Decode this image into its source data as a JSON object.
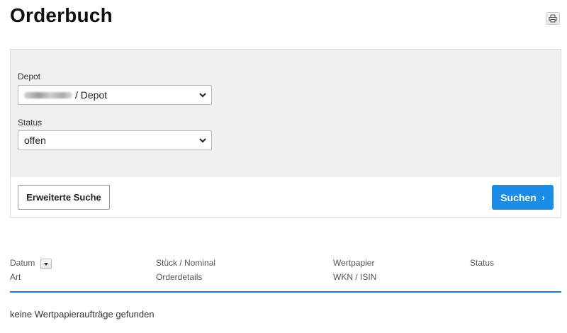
{
  "page": {
    "title": "Orderbuch",
    "print_icon": "printer-icon"
  },
  "search": {
    "depot_label": "Depot",
    "depot_value": "/ Depot",
    "status_label": "Status",
    "status_value": "offen",
    "advanced_label": "Erweiterte Suche",
    "submit_label": "Suchen",
    "submit_icon": "chevron-right-icon",
    "submit_color": "#1a8ee6"
  },
  "table": {
    "headers_row1": [
      "Datum",
      "Stück / Nominal",
      "Wertpapier",
      "Status"
    ],
    "headers_row2": [
      "Art",
      "Orderdetails",
      "WKN / ISIN"
    ],
    "sort_icon": "sort-down-icon",
    "divider_color": "#1a7fd4"
  },
  "empty_message": "keine Wertpapieraufträge gefunden"
}
